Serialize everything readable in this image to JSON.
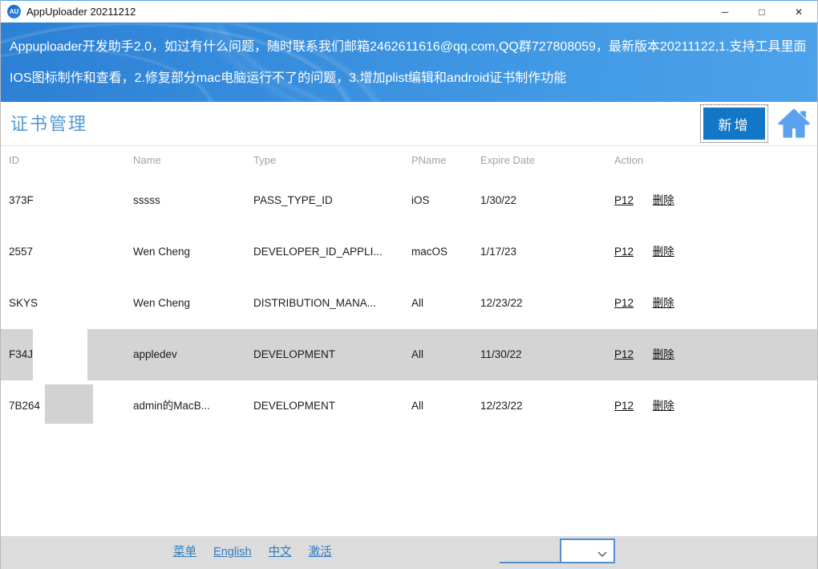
{
  "window": {
    "title": "AppUploader 20211212",
    "app_icon_text": "AU",
    "controls": {
      "minimize": "─",
      "maximize": "□",
      "close": "✕"
    }
  },
  "banner": {
    "line1": "Appuploader开发助手2.0，如过有什么问题，随时联系我们邮箱2462611616@qq.com,QQ群727808059，最新版本20211122,1.支持工具里面",
    "line2": "IOS图标制作和查看，2.修复部分mac电脑运行不了的问题，3.增加plist编辑和android证书制作功能"
  },
  "page": {
    "title": "证书管理",
    "add_button_label": "新增"
  },
  "table": {
    "columns": [
      "ID",
      "Name",
      "Type",
      "PName",
      "Expire Date",
      "Action"
    ],
    "action_links": {
      "p12": "P12",
      "delete": "删除"
    },
    "rows": [
      {
        "id": "373F",
        "name": "sssss",
        "type": "PASS_TYPE_ID",
        "pname": "iOS",
        "expire": "1/30/22"
      },
      {
        "id": "2557",
        "name": "Wen Cheng",
        "type": "DEVELOPER_ID_APPLI...",
        "pname": "macOS",
        "expire": "1/17/23"
      },
      {
        "id": "SKYS",
        "name": "Wen Cheng",
        "type": "DISTRIBUTION_MANA...",
        "pname": "All",
        "expire": "12/23/22"
      },
      {
        "id": "F34J",
        "name": "appledev",
        "type": "DEVELOPMENT",
        "pname": "All",
        "expire": "11/30/22"
      },
      {
        "id": "7B264",
        "name": "admin的MacB...",
        "type": "DEVELOPMENT",
        "pname": "All",
        "expire": "12/23/22"
      }
    ]
  },
  "footer": {
    "links": [
      "菜单",
      "English",
      "中文",
      "激活"
    ],
    "combo_value": ""
  },
  "colors": {
    "accent_blue": "#1377c8",
    "banner_blue_start": "#2c80d5",
    "banner_blue_end": "#4da3ea",
    "title_blue": "#4f9ad6",
    "link_blue": "#2f7cc0",
    "selected_row": "#d4d4d4",
    "footer_gray": "#dcdcdc",
    "header_text_gray": "#a2a2a2",
    "home_icon_blue": "#5aa2f0"
  }
}
